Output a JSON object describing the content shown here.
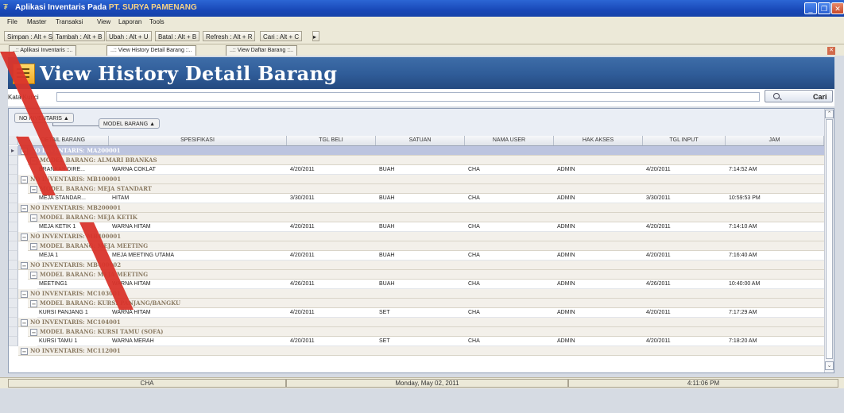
{
  "window": {
    "title_prefix": "Aplikasi Inventaris Pada ",
    "title_company": "PT. SURYA PAMENANG",
    "minimize": "_",
    "maximize": "❐",
    "close": "✕"
  },
  "menu": [
    "File",
    "Master",
    "Transaksi",
    "View",
    "Laporan",
    "Tools"
  ],
  "toolbar": [
    "Simpan : Alt + S",
    "Tambah : Alt + B",
    "Ubah : Alt + U",
    "Batal : Alt + B",
    "Refresh : Alt + R",
    "Cari : Alt + C"
  ],
  "tabs": [
    "..:: Aplikasi Inventaris ::..",
    "..:: View History Detail Barang ::..",
    "..:: View Daftar Barang ::.."
  ],
  "page_title": "View History Detail Barang",
  "search": {
    "label": "Kata Kunci",
    "value": "",
    "button": "Cari"
  },
  "group_by": [
    "NO INVENTARIS",
    "MODEL BARANG"
  ],
  "columns": [
    "DETAIL BARANG",
    "SPESIFIKASI",
    "TGL BELI",
    "SATUAN",
    "NAMA USER",
    "HAK AKSES",
    "TGL INPUT",
    "JAM"
  ],
  "groups": [
    {
      "no": "NO INVENTARIS: MA200001",
      "model": "MODEL BARANG: ALMARI BRANKAS",
      "row": [
        "BRANKAS DIRE...",
        "WARNA COKLAT",
        "4/20/2011",
        "BUAH",
        "CHA",
        "ADMIN",
        "4/20/2011",
        "7:14:52 AM"
      ]
    },
    {
      "no": "NO INVENTARIS: MB100001",
      "model": "MODEL BARANG: MEJA STANDART",
      "row": [
        "MEJA STANDAR...",
        "HITAM",
        "3/30/2011",
        "BUAH",
        "CHA",
        "ADMIN",
        "3/30/2011",
        "10:59:53 PM"
      ]
    },
    {
      "no": "NO INVENTARIS: MB200001",
      "model": "MODEL BARANG: MEJA KETIK",
      "row": [
        "MEJA KETIK 1",
        "WARNA HITAM",
        "4/20/2011",
        "BUAH",
        "CHA",
        "ADMIN",
        "4/20/2011",
        "7:14:10 AM"
      ]
    },
    {
      "no": "NO INVENTARIS: MB400001",
      "model": "MODEL BARANG: MEJA MEETING",
      "row": [
        "MEJA 1",
        "MEJA MEETING UTAMA",
        "4/20/2011",
        "BUAH",
        "CHA",
        "ADMIN",
        "4/20/2011",
        "7:16:40 AM"
      ]
    },
    {
      "no": "NO INVENTARIS: MB400002",
      "model": "MODEL BARANG: MEJA MEETING",
      "row": [
        "MEETING1",
        "WARNA HITAM",
        "4/26/2011",
        "BUAH",
        "CHA",
        "ADMIN",
        "4/26/2011",
        "10:40:00 AM"
      ]
    },
    {
      "no": "NO INVENTARIS: MC103001",
      "model": "MODEL BARANG: KURSI PANJANG/BANGKU",
      "row": [
        "KURSI PANJANG 1",
        "WARNA HITAM",
        "4/20/2011",
        "SET",
        "CHA",
        "ADMIN",
        "4/20/2011",
        "7:17:29 AM"
      ]
    },
    {
      "no": "NO INVENTARIS: MC104001",
      "model": "MODEL BARANG: KURSI TAMU (SOFA)",
      "row": [
        "KURSI TAMU 1",
        "WARNA MERAH",
        "4/20/2011",
        "SET",
        "CHA",
        "ADMIN",
        "4/20/2011",
        "7:18:20 AM"
      ]
    }
  ],
  "partial_group": "NO INVENTARIS: MC112001",
  "status": {
    "user": "CHA",
    "date": "Monday, May 02, 2011",
    "time": "4:11:06 PM"
  },
  "colors": {
    "header_bg": "#2f5c98",
    "group_text": "#8a7a62",
    "selected_row": "#bcc4df",
    "watermark": "#d9342b"
  }
}
